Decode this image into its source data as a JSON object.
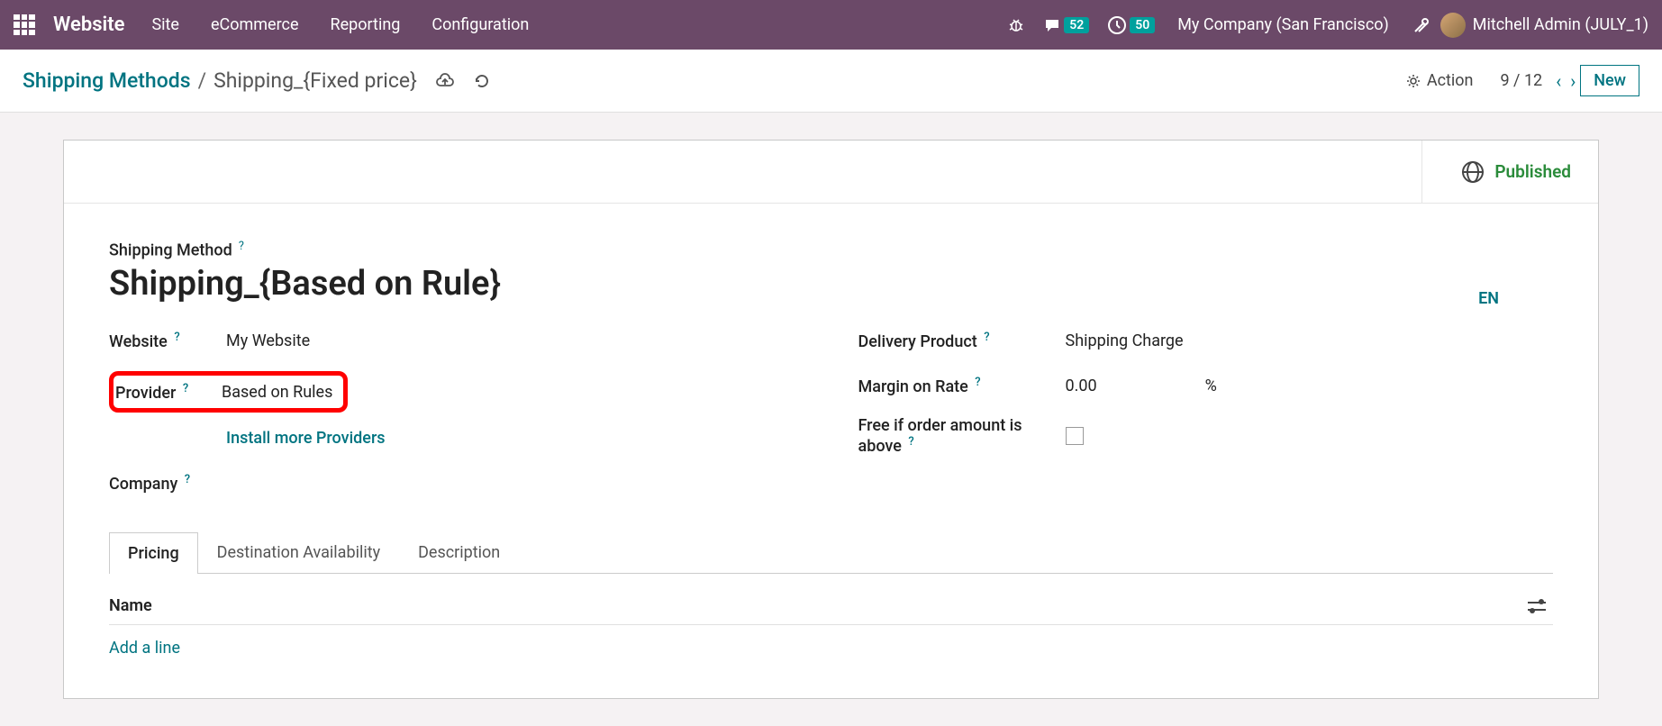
{
  "nav": {
    "brand": "Website",
    "links": [
      "Site",
      "eCommerce",
      "Reporting",
      "Configuration"
    ],
    "chat_count": "52",
    "clock_count": "50",
    "company": "My Company (San Francisco)",
    "user": "Mitchell Admin (JULY_1)"
  },
  "breadcrumb": {
    "root": "Shipping Methods",
    "current": "Shipping_{Fixed price}"
  },
  "controls": {
    "action": "Action",
    "pager": "9 / 12",
    "new": "New"
  },
  "status": {
    "published": "Published"
  },
  "form": {
    "title_label": "Shipping Method",
    "title_value": "Shipping_{Based on Rule}",
    "lang": "EN",
    "website_label": "Website",
    "website_value": "My Website",
    "provider_label": "Provider",
    "provider_value": "Based on Rules",
    "install_more": "Install more Providers",
    "company_label": "Company",
    "delivery_product_label": "Delivery Product",
    "delivery_product_value": "Shipping Charge",
    "margin_label": "Margin on Rate",
    "margin_value": "0.00",
    "margin_unit": "%",
    "free_if_label": "Free if order amount is above"
  },
  "tabs": [
    "Pricing",
    "Destination Availability",
    "Description"
  ],
  "table": {
    "header_name": "Name",
    "add_line": "Add a line"
  }
}
